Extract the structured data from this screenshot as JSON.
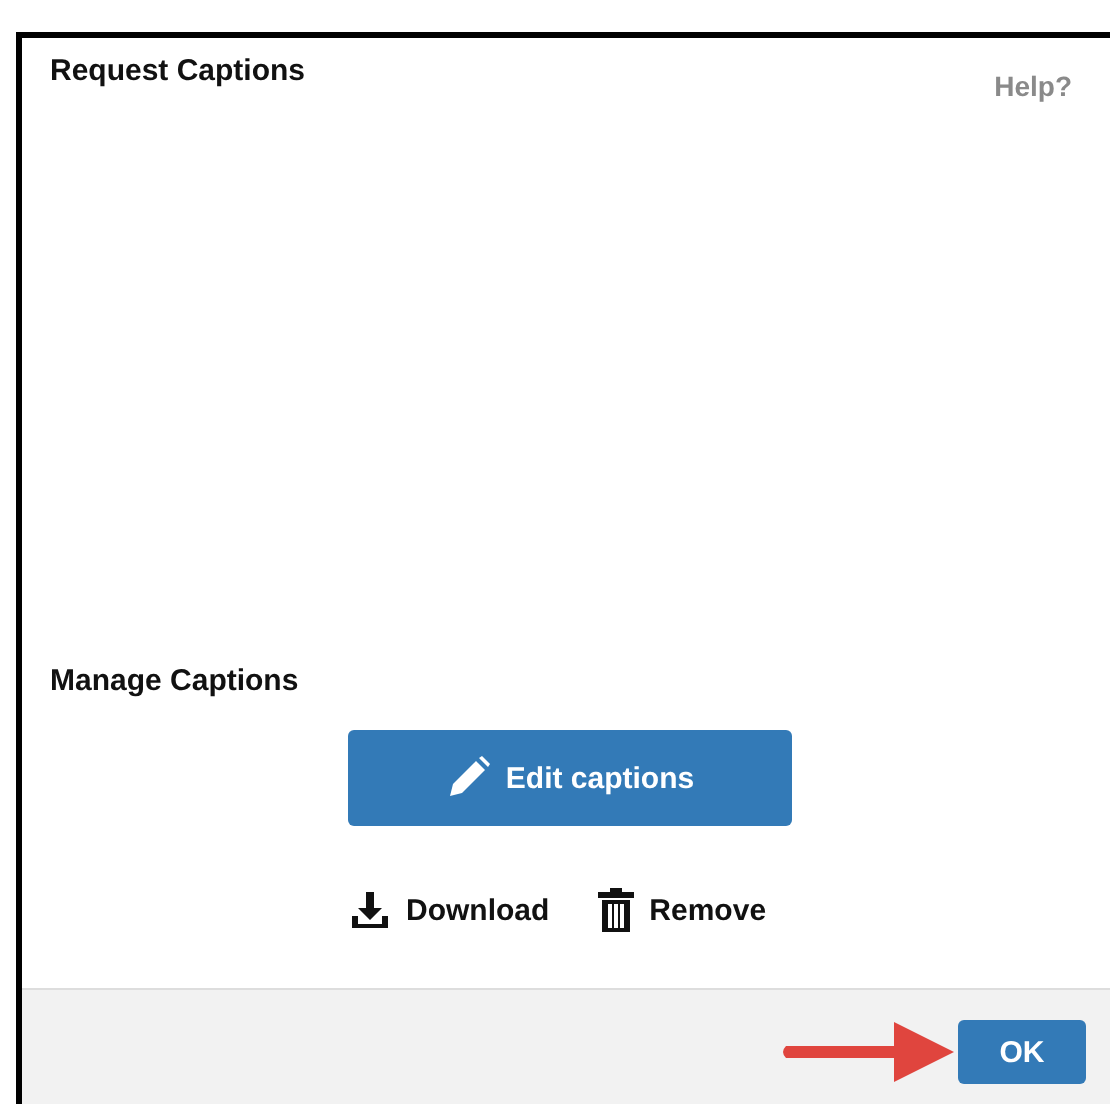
{
  "dialog": {
    "title": "Request Captions",
    "help": "Help?"
  },
  "manage": {
    "heading": "Manage Captions",
    "edit_button": "Edit captions",
    "actions": [
      {
        "kind": "download",
        "label": "Download"
      },
      {
        "kind": "remove",
        "label": "Remove"
      }
    ]
  },
  "footer": {
    "ok_button": "OK"
  }
}
